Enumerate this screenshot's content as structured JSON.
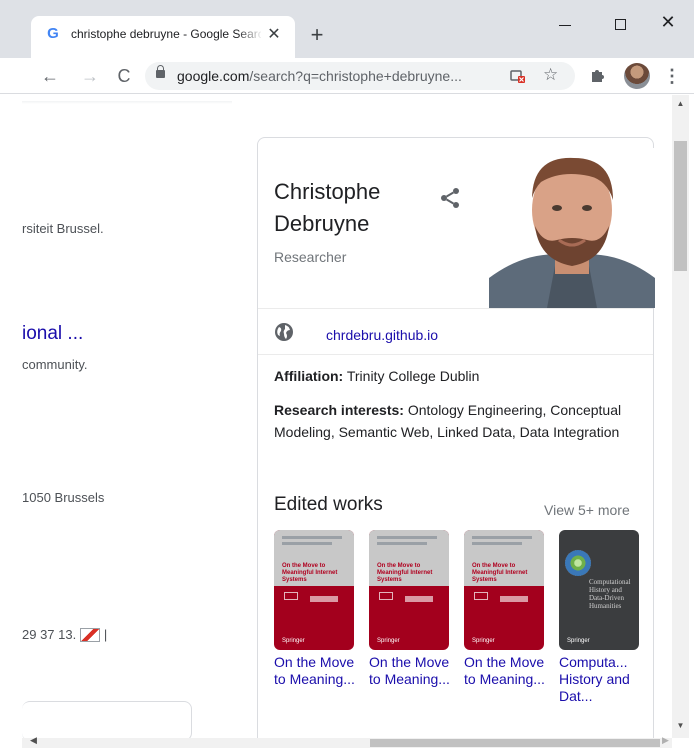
{
  "browser": {
    "tab": {
      "title": "christophe debruyne - Google Search",
      "favicon": "G",
      "close_label": "✕"
    },
    "new_tab_label": "+",
    "window_controls": {
      "close_label": "✕"
    },
    "nav": {
      "back": "←",
      "forward": "→",
      "reload": "C"
    },
    "address": {
      "host": "google.com",
      "path": "/search?q=christophe+debruyne..."
    },
    "icons": {
      "star": "☆",
      "menu": "⋮"
    }
  },
  "results": {
    "snippet_1": "rsiteit Brussel.",
    "link_1": "ional ...",
    "snippet_2": "community.",
    "snippet_3": "1050 Brussels",
    "snippet_4": "29 37 13.",
    "snippet_4_tail": "|"
  },
  "knowledge_panel": {
    "name": "Christophe Debruyne",
    "subtitle": "Researcher",
    "website": "chrdebru.github.io",
    "facts": [
      {
        "label": "Affiliation:",
        "value": "Trinity College Dublin"
      },
      {
        "label": "Research interests:",
        "value": "Ontology Engineering, Conceptual Modeling, Semantic Web, Linked Data, Data Integration"
      }
    ],
    "edited_works": {
      "title": "Edited works",
      "view_more": "View 5+ more",
      "books": [
        {
          "label": "On the Move to Meaning...",
          "cover_title": "On the Move to Meaningful Internet Systems",
          "publisher": "Springer"
        },
        {
          "label": "On the Move to Meaning...",
          "cover_title": "On the Move to Meaningful Internet Systems",
          "publisher": "Springer"
        },
        {
          "label": "On the Move to Meaning...",
          "cover_title": "On the Move to Meaningful Internet Systems",
          "publisher": "Springer"
        },
        {
          "label": "Computa... History and Dat...",
          "cover_title": "Computational History and Data-Driven Humanities",
          "publisher": "Springer"
        }
      ]
    }
  },
  "colors": {
    "link": "#1a0dab",
    "tab_strip": "#dee1e6",
    "book_red": "#a3001d",
    "book_dark": "#3b3d3f"
  }
}
